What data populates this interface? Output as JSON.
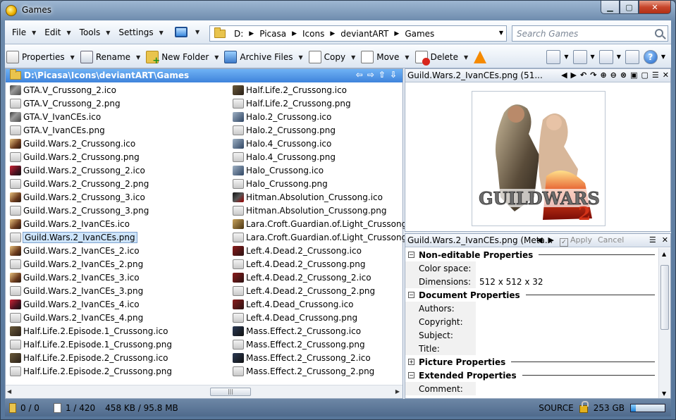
{
  "window": {
    "title": "Games"
  },
  "menu": [
    "File",
    "Edit",
    "Tools",
    "Settings"
  ],
  "address": {
    "drive": "D:",
    "crumbs": [
      "Picasa",
      "Icons",
      "deviantART",
      "Games"
    ]
  },
  "search": {
    "placeholder": "Search Games"
  },
  "toolbar": {
    "properties": "Properties",
    "rename": "Rename",
    "new_folder": "New Folder",
    "archive": "Archive Files",
    "copy": "Copy",
    "move": "Move",
    "delete": "Delete"
  },
  "file_pane": {
    "path": "D:\\Picasa\\Icons\\deviantART\\Games",
    "selected": "Guild.Wars.2_IvanCEs.png",
    "col1": [
      {
        "name": "GTA.V_Crussong_2.ico",
        "icon": "gta"
      },
      {
        "name": "GTA.V_Crussong_2.png",
        "icon": "png"
      },
      {
        "name": "GTA.V_IvanCEs.ico",
        "icon": "gta"
      },
      {
        "name": "GTA.V_IvanCEs.png",
        "icon": "png"
      },
      {
        "name": "Guild.Wars.2_Crussong.ico",
        "icon": "gw"
      },
      {
        "name": "Guild.Wars.2_Crussong.png",
        "icon": "png"
      },
      {
        "name": "Guild.Wars.2_Crussong_2.ico",
        "icon": "gwb"
      },
      {
        "name": "Guild.Wars.2_Crussong_2.png",
        "icon": "png"
      },
      {
        "name": "Guild.Wars.2_Crussong_3.ico",
        "icon": "gw"
      },
      {
        "name": "Guild.Wars.2_Crussong_3.png",
        "icon": "png"
      },
      {
        "name": "Guild.Wars.2_IvanCEs.ico",
        "icon": "gw"
      },
      {
        "name": "Guild.Wars.2_IvanCEs.png",
        "icon": "png"
      },
      {
        "name": "Guild.Wars.2_IvanCEs_2.ico",
        "icon": "gw"
      },
      {
        "name": "Guild.Wars.2_IvanCEs_2.png",
        "icon": "png"
      },
      {
        "name": "Guild.Wars.2_IvanCEs_3.ico",
        "icon": "gw"
      },
      {
        "name": "Guild.Wars.2_IvanCEs_3.png",
        "icon": "png"
      },
      {
        "name": "Guild.Wars.2_IvanCEs_4.ico",
        "icon": "gwb"
      },
      {
        "name": "Guild.Wars.2_IvanCEs_4.png",
        "icon": "png"
      },
      {
        "name": "Half.Life.2.Episode.1_Crussong.ico",
        "icon": "hl"
      },
      {
        "name": "Half.Life.2.Episode.1_Crussong.png",
        "icon": "png"
      },
      {
        "name": "Half.Life.2.Episode.2_Crussong.ico",
        "icon": "hl"
      },
      {
        "name": "Half.Life.2.Episode.2_Crussong.png",
        "icon": "png"
      }
    ],
    "col2": [
      {
        "name": "Half.Life.2_Crussong.ico",
        "icon": "hl"
      },
      {
        "name": "Half.Life.2_Crussong.png",
        "icon": "png"
      },
      {
        "name": "Halo.2_Crussong.ico",
        "icon": "halo"
      },
      {
        "name": "Halo.2_Crussong.png",
        "icon": "png"
      },
      {
        "name": "Halo.4_Crussong.ico",
        "icon": "halo"
      },
      {
        "name": "Halo.4_Crussong.png",
        "icon": "png"
      },
      {
        "name": "Halo_Crussong.ico",
        "icon": "halo"
      },
      {
        "name": "Halo_Crussong.png",
        "icon": "png"
      },
      {
        "name": "Hitman.Absolution_Crussong.ico",
        "icon": "hit"
      },
      {
        "name": "Hitman.Absolution_Crussong.png",
        "icon": "png"
      },
      {
        "name": "Lara.Croft.Guardian.of.Light_Crussong.ico",
        "icon": "lara"
      },
      {
        "name": "Lara.Croft.Guardian.of.Light_Crussong.png",
        "icon": "png"
      },
      {
        "name": "Left.4.Dead.2_Crussong.ico",
        "icon": "l4d"
      },
      {
        "name": "Left.4.Dead.2_Crussong.png",
        "icon": "png"
      },
      {
        "name": "Left.4.Dead.2_Crussong_2.ico",
        "icon": "l4d"
      },
      {
        "name": "Left.4.Dead.2_Crussong_2.png",
        "icon": "png"
      },
      {
        "name": "Left.4.Dead_Crussong.ico",
        "icon": "l4d"
      },
      {
        "name": "Left.4.Dead_Crussong.png",
        "icon": "png"
      },
      {
        "name": "Mass.Effect.2_Crussong.ico",
        "icon": "me"
      },
      {
        "name": "Mass.Effect.2_Crussong.png",
        "icon": "png"
      },
      {
        "name": "Mass.Effect.2_Crussong_2.ico",
        "icon": "me"
      },
      {
        "name": "Mass.Effect.2_Crussong_2.png",
        "icon": "png"
      }
    ]
  },
  "preview_pane": {
    "title": "Guild.Wars.2_IvanCEs.png (51..."
  },
  "meta_pane": {
    "title": "Guild.Wars.2_IvanCEs.png (Meta...",
    "apply": "Apply",
    "cancel": "Cancel",
    "sections": [
      {
        "label": "Non-editable Properties",
        "expanded": true,
        "rows": [
          {
            "key": "Color space:",
            "value": ""
          },
          {
            "key": "Dimensions:",
            "value": "512 x 512 x 32"
          }
        ]
      },
      {
        "label": "Document Properties",
        "expanded": true,
        "rows": [
          {
            "key": "Authors:",
            "value": ""
          },
          {
            "key": "Copyright:",
            "value": ""
          },
          {
            "key": "Subject:",
            "value": ""
          },
          {
            "key": "Title:",
            "value": ""
          }
        ]
      },
      {
        "label": "Picture Properties",
        "expanded": false,
        "rows": []
      },
      {
        "label": "Extended Properties",
        "expanded": true,
        "rows": [
          {
            "key": "Comment:",
            "value": ""
          }
        ]
      }
    ]
  },
  "status": {
    "folders": "0 / 0",
    "files": "1 / 420",
    "size": "458 KB / 95.8 MB",
    "source": "SOURCE",
    "free": "253 GB",
    "drive_used_fraction": 0.15
  }
}
